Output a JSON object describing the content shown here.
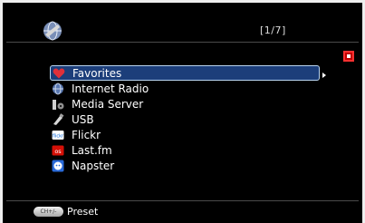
{
  "header": {
    "page_counter": "[1/7]"
  },
  "menu": {
    "items": [
      {
        "label": "Favorites",
        "icon": "heart-icon",
        "selected": true
      },
      {
        "label": "Internet Radio",
        "icon": "globe-icon"
      },
      {
        "label": "Media Server",
        "icon": "media-server-icon"
      },
      {
        "label": "USB",
        "icon": "usb-icon"
      },
      {
        "label": "Flickr",
        "icon": "flickr-icon"
      },
      {
        "label": "Last.fm",
        "icon": "lastfm-icon"
      },
      {
        "label": "Napster",
        "icon": "napster-icon"
      }
    ]
  },
  "footer": {
    "button_label": "CH+/-",
    "action_label": "Preset"
  },
  "colors": {
    "background": "#000000",
    "selection_fill": "#1c3e7a",
    "selection_border": "#b8d4f0",
    "stop_indicator": "#ff3030"
  }
}
